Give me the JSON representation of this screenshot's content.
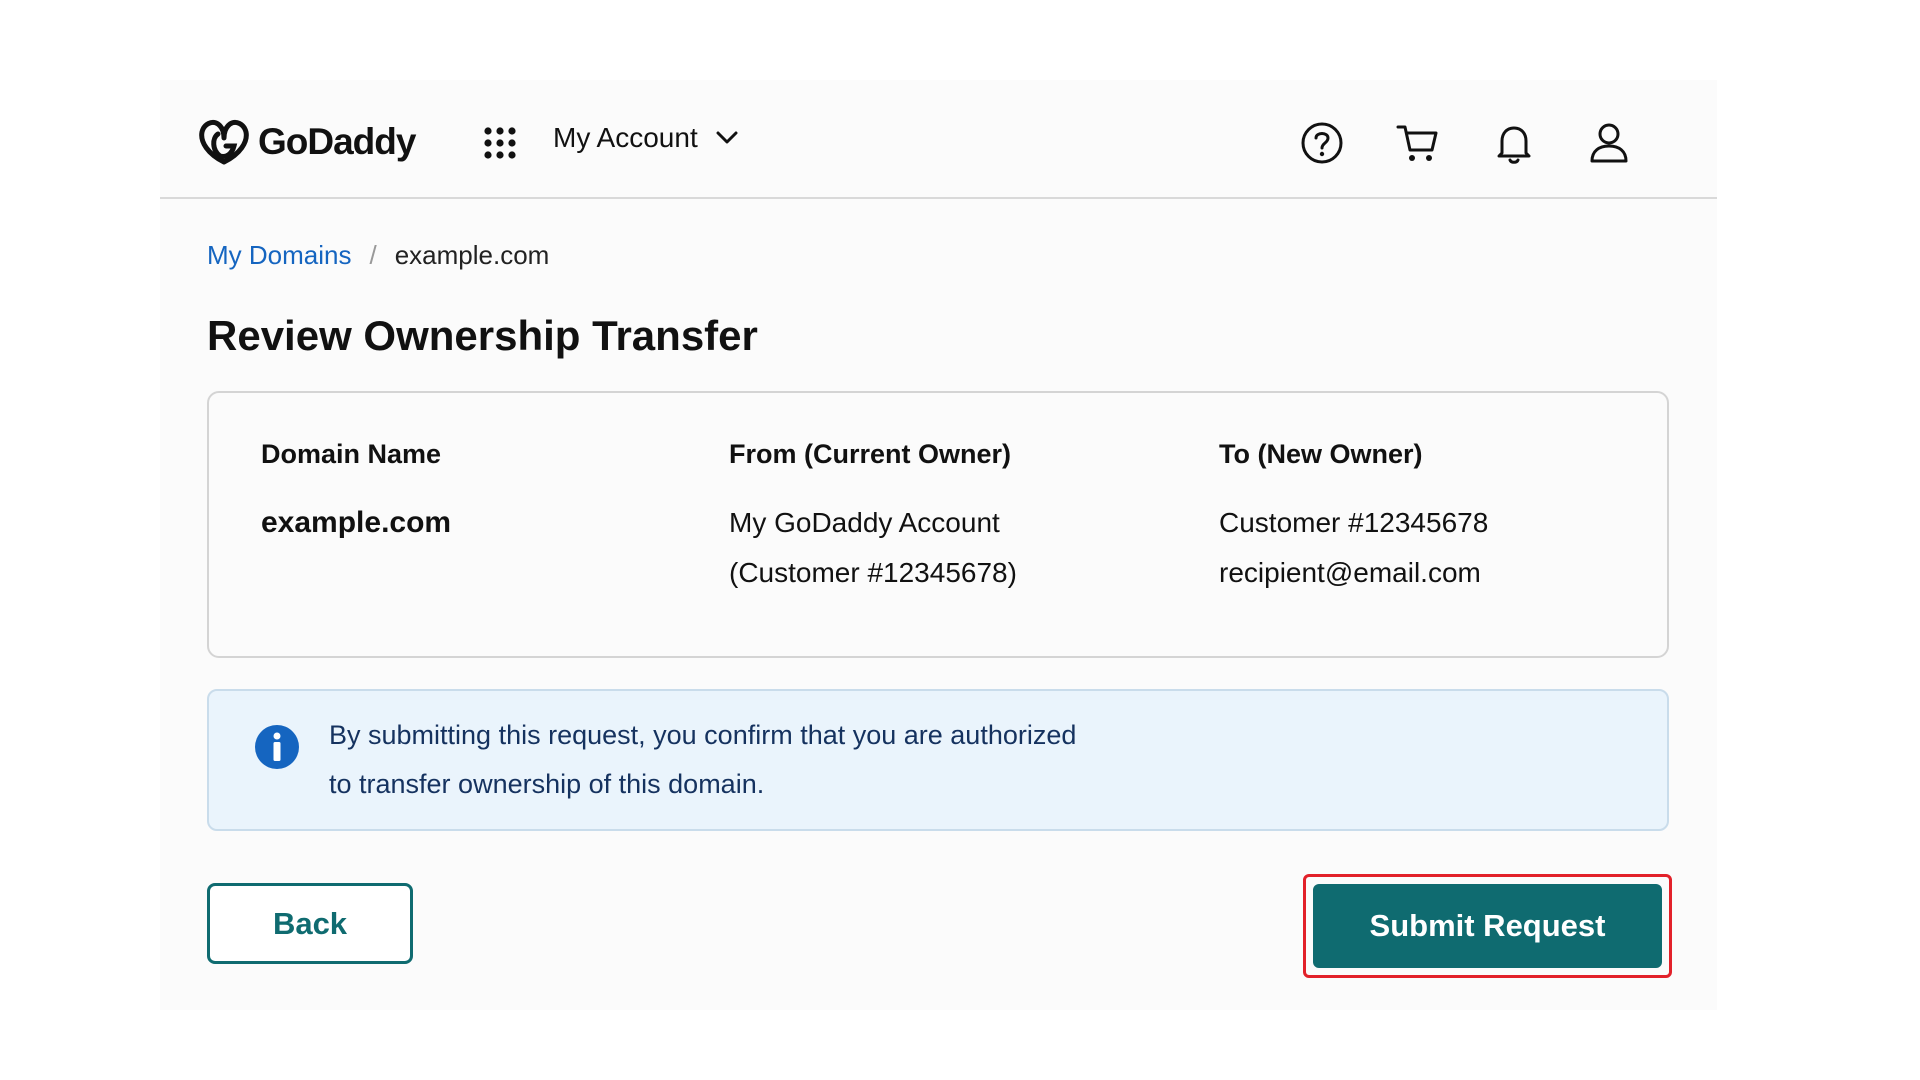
{
  "header": {
    "logo_text": "GoDaddy",
    "account_menu_label": "My Account",
    "icons": [
      "help-icon",
      "cart-icon",
      "bell-icon",
      "user-icon"
    ]
  },
  "breadcrumb": {
    "parent": "My Domains",
    "separator": "/",
    "current": "example.com"
  },
  "page_title": "Review Ownership Transfer",
  "summary": {
    "domain_header": "Domain Name",
    "domain_value": "example.com",
    "from_header": "From (Current Owner)",
    "from_line1": "My GoDaddy Account",
    "from_line2": "(Customer #12345678)",
    "to_header": "To (New Owner)",
    "to_line1": "Customer #12345678",
    "to_line2": "recipient@email.com"
  },
  "notice": {
    "line1": "By submitting this request, you confirm that you are authorized",
    "line2": "to transfer ownership of this domain."
  },
  "actions": {
    "back_label": "Back",
    "submit_label": "Submit Request"
  },
  "colors": {
    "brand_teal": "#0f6b70",
    "link_blue": "#1565c0",
    "info_bg": "#eaf4fc",
    "highlight_red": "#e2212a"
  }
}
